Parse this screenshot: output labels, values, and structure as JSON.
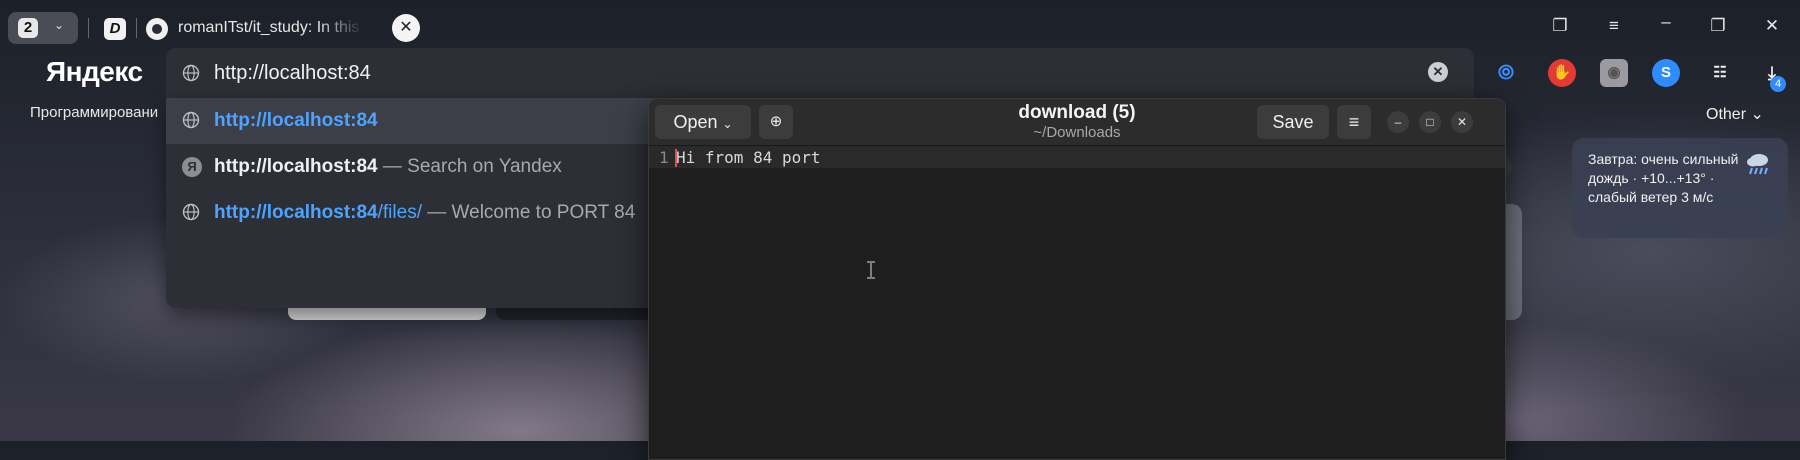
{
  "browser": {
    "tab_count": "2",
    "active_tab_title": "romanITst/it_study: In this",
    "logo": "Яндекс",
    "bookmark_left": "Программировани",
    "bookmark_other": "Other",
    "download_badge": "4",
    "omnibox": {
      "value": "http://localhost:84"
    },
    "suggestions": [
      {
        "url": "http://localhost:84",
        "suffix": "",
        "note": "",
        "selected": true
      },
      {
        "url": "http://localhost:84",
        "suffix": "",
        "note": " — Search on Yandex",
        "selected": false
      },
      {
        "url": "http://localhost:84",
        "suffix": "/files/",
        "note": " — Welcome to PORT 84",
        "selected": false
      }
    ]
  },
  "weather": {
    "text": "Завтра: очень сильный дождь · +10...+13° · слабый ветер 3 м/с"
  },
  "gedit": {
    "open_label": "Open",
    "title": "download (5)",
    "subtitle": "~/Downloads",
    "save_label": "Save",
    "lines": [
      {
        "number": "1",
        "text": "Hi from 84 port"
      }
    ]
  }
}
